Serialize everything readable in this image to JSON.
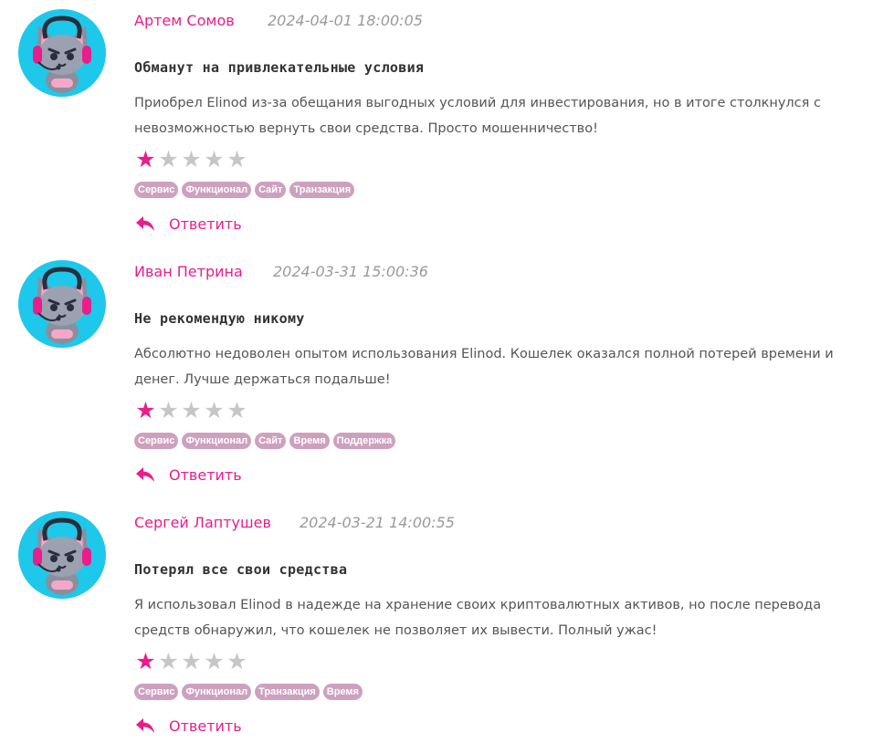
{
  "colors": {
    "accent": "#e91e8c",
    "tag_bg": "#cda1be",
    "avatar_bg": "#1ec8ea",
    "star_off": "#c6c6c6"
  },
  "reply_label": "Ответить",
  "reviews": [
    {
      "author": "Артем Сомов",
      "date": "2024-04-01 18:00:05",
      "title": "Обманут на привлекательные условия",
      "text": "Приобрел Elinod из-за обещания выгодных условий для инвестирования, но в итоге столкнулся с невозможностью вернуть свои средства. Просто мошенничество!",
      "rating": 1,
      "max_rating": 5,
      "tags": [
        "Сервис",
        "Функционал",
        "Сайт",
        "Транзакция"
      ]
    },
    {
      "author": "Иван Петрина",
      "date": "2024-03-31 15:00:36",
      "title": "Не рекомендую никому",
      "text": "Абсолютно недоволен опытом использования Elinod. Кошелек оказался полной потерей времени и денег. Лучше держаться подальше!",
      "rating": 1,
      "max_rating": 5,
      "tags": [
        "Сервис",
        "Функционал",
        "Сайт",
        "Время",
        "Поддержка"
      ]
    },
    {
      "author": "Сергей Лаптушев",
      "date": "2024-03-21 14:00:55",
      "title": "Потерял все свои средства",
      "text": "Я использовал Elinod в надежде на хранение своих криптовалютных активов, но после перевода средств обнаружил, что кошелек не позволяет их вывести. Полный ужас!",
      "rating": 1,
      "max_rating": 5,
      "tags": [
        "Сервис",
        "Функционал",
        "Транзакция",
        "Время"
      ]
    }
  ]
}
